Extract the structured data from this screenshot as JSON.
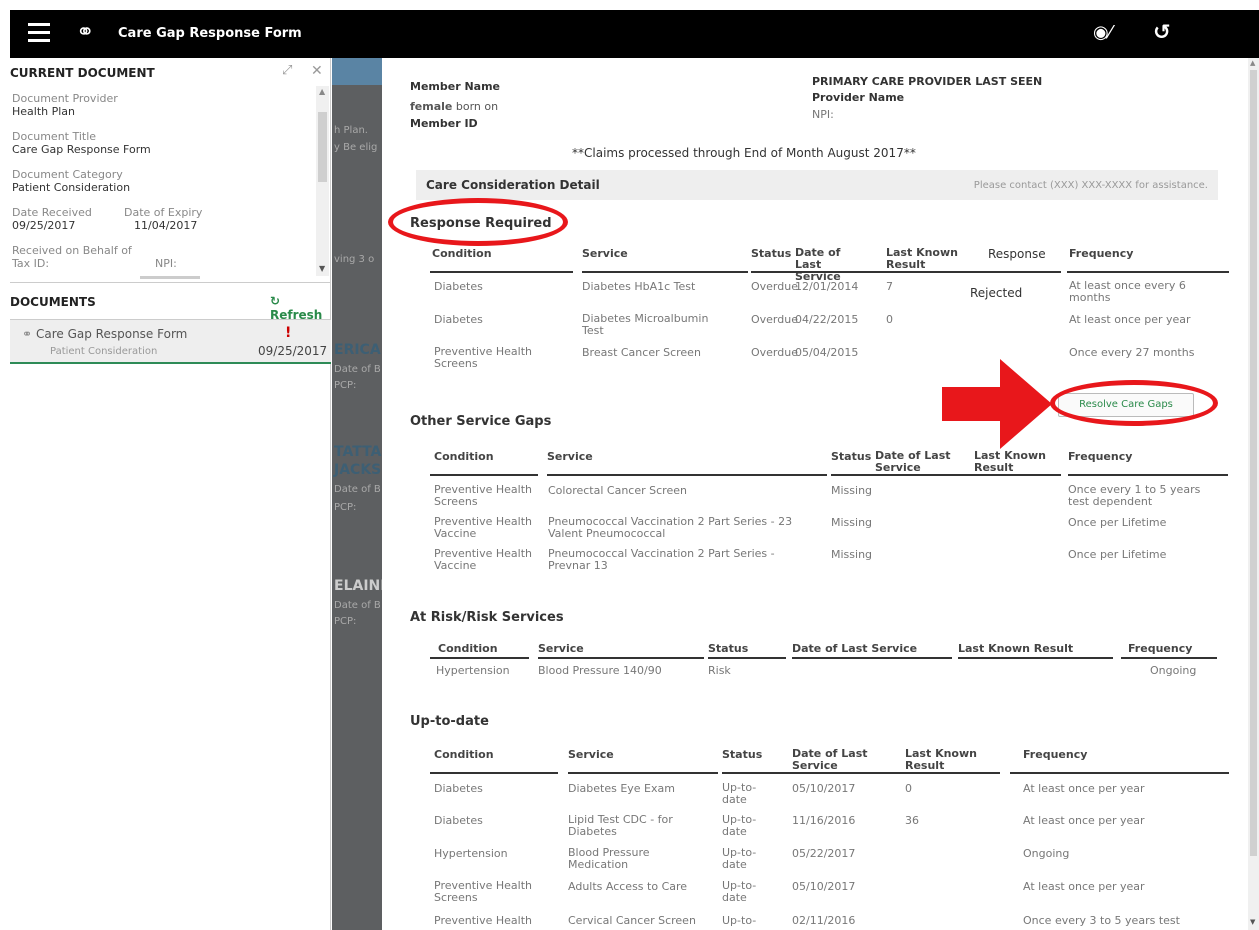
{
  "app": {
    "title": "Care Gap Response Form",
    "menu_icon": "hamburger-menu-icon",
    "logo_icon": "link-icon",
    "hide_icon": "eye-slash-icon",
    "undo_icon": "undo-icon"
  },
  "left_panel": {
    "current_document_title": "CURRENT DOCUMENT",
    "fields": [
      {
        "label": "Document Provider",
        "value": "Health Plan"
      },
      {
        "label": "Document Title",
        "value": "Care Gap Response Form"
      },
      {
        "label": "Document Category",
        "value": "Patient Consideration"
      }
    ],
    "date_received_label": "Date Received",
    "date_received": "09/25/2017",
    "date_expiry_label": "Date of Expiry",
    "date_expiry": "11/04/2017",
    "received_behalf_label": "Received on Behalf of",
    "tax_id_label": "Tax ID:",
    "npi_label": "NPI:",
    "documents_title": "DOCUMENTS",
    "refresh_label": "Refresh",
    "document": {
      "name": "Care Gap Response Form",
      "category": "Patient Consideration",
      "date": "09/25/2017"
    }
  },
  "backdrop": {
    "lines": [
      "h Plan.",
      "y Be elig",
      "ving 3 o",
      "ERICA",
      "Date of B",
      "PCP:",
      "TATTA",
      "JACKS",
      "Date of B",
      "PCP:",
      "ELAINE",
      "Date of B",
      "PCP:"
    ]
  },
  "form": {
    "member_name_label": "Member Name",
    "female_label": "female",
    "born_on_label": "born on",
    "member_id_label": "Member ID",
    "pcp_heading": "PRIMARY CARE PROVIDER LAST SEEN",
    "provider_name_label": "Provider Name",
    "npi_label": "NPI:",
    "claims_note": "**Claims processed through End of Month August 2017**",
    "detail_title": "Care Consideration Detail",
    "contact_note": "Please contact (XXX) XXX-XXXX for assistance.",
    "response_required": {
      "title": "Response Required",
      "headers": [
        "Condition",
        "Service",
        "Status",
        "Date of Last Service",
        "Last Known Result",
        "Response",
        "Frequency"
      ],
      "rows": [
        [
          "Diabetes",
          "Diabetes HbA1c Test",
          "Overdue",
          "12/01/2014",
          "7",
          "Rejected",
          "At least once every 6 months"
        ],
        [
          "Diabetes",
          "Diabetes Microalbumin Test",
          "Overdue",
          "04/22/2015",
          "0",
          "",
          "At least once per year"
        ],
        [
          "Preventive Health Screens",
          "Breast Cancer Screen",
          "Overdue",
          "05/04/2015",
          "",
          "",
          "Once every 27 months"
        ]
      ],
      "resolve_button": "Resolve Care Gaps"
    },
    "other_gaps": {
      "title": "Other Service Gaps",
      "headers": [
        "Condition",
        "Service",
        "Status",
        "Date of Last Service",
        "Last Known Result",
        "Frequency"
      ],
      "rows": [
        [
          "Preventive Health Screens",
          "Colorectal Cancer Screen",
          "Missing",
          "",
          "",
          "Once every 1 to 5 years test dependent"
        ],
        [
          "Preventive Health Vaccine",
          "Pneumococcal Vaccination 2 Part Series - 23 Valent Pneumococcal",
          "Missing",
          "",
          "",
          "Once per Lifetime"
        ],
        [
          "Preventive Health Vaccine",
          "Pneumococcal Vaccination 2 Part Series - Prevnar 13",
          "Missing",
          "",
          "",
          "Once per Lifetime"
        ]
      ]
    },
    "at_risk": {
      "title": "At Risk/Risk Services",
      "headers": [
        "Condition",
        "Service",
        "Status",
        "Date of Last Service",
        "Last Known Result",
        "Frequency"
      ],
      "rows": [
        [
          "Hypertension",
          "Blood Pressure 140/90",
          "Risk",
          "",
          "",
          "Ongoing"
        ]
      ]
    },
    "up_to_date": {
      "title": "Up-to-date",
      "headers": [
        "Condition",
        "Service",
        "Status",
        "Date of Last Service",
        "Last Known Result",
        "Frequency"
      ],
      "rows": [
        [
          "Diabetes",
          "Diabetes Eye Exam",
          "Up-to-date",
          "05/10/2017",
          "0",
          "At least once per year"
        ],
        [
          "Diabetes",
          "Lipid Test CDC - for Diabetes",
          "Up-to-date",
          "11/16/2016",
          "36",
          "At least once per year"
        ],
        [
          "Hypertension",
          "Blood Pressure Medication",
          "Up-to-date",
          "05/22/2017",
          "",
          "Ongoing"
        ],
        [
          "Preventive Health Screens",
          "Adults Access to Care",
          "Up-to-date",
          "05/10/2017",
          "",
          "At least once per year"
        ],
        [
          "Preventive Health",
          "Cervical Cancer Screen",
          "Up-to-",
          "02/11/2016",
          "",
          "Once every 3 to 5 years test"
        ]
      ]
    }
  },
  "colors": {
    "annotation_red": "#e8171b",
    "accent_green": "#2a8a4a",
    "topbar": "#000000"
  }
}
